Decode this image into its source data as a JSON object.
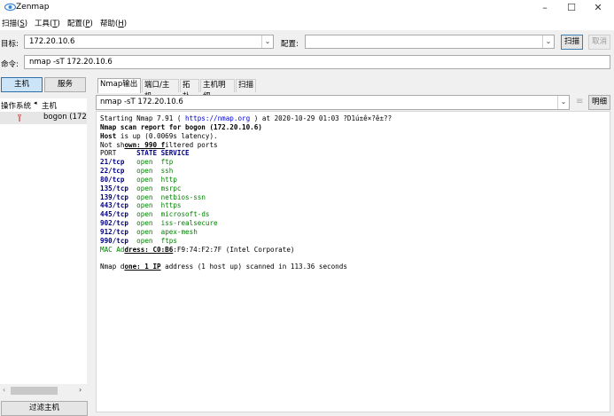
{
  "window": {
    "title": "Zenmap",
    "controls": [
      "–",
      "☐",
      "✕"
    ]
  },
  "menu": [
    {
      "label": "扫描(S)",
      "pre": "扫描(",
      "key": "S",
      "post": ")"
    },
    {
      "label": "工具(T)",
      "pre": "工具(",
      "key": "T",
      "post": ")"
    },
    {
      "label": "配置(P)",
      "pre": "配置(",
      "key": "P",
      "post": ")"
    },
    {
      "label": "帮助(H)",
      "pre": "帮助(",
      "key": "H",
      "post": ")"
    }
  ],
  "toolbar": {
    "target_label": "目标:",
    "target_value": "172.20.10.6",
    "profile_label": "配置:",
    "profile_value": "",
    "scan_button": "扫描",
    "cancel_button": "取消",
    "command_label": "命令:",
    "command_value": "nmap -sT 172.20.10.6"
  },
  "left_panel": {
    "hosts_button": "主机",
    "services_button": "服务",
    "os_column": "操作系统",
    "host_column": "主机",
    "hosts": [
      {
        "name": "bogon (172"
      }
    ],
    "filter_button": "过滤主机"
  },
  "tabs": [
    "Nmap输出",
    "端口/主机",
    "拓扑",
    "主机明细",
    "扫描"
  ],
  "output_panel": {
    "command_select": "nmap -sT 172.20.10.6",
    "details_button": "明细",
    "lines": {
      "start_pre": "Starting Nmap 7.91 ( ",
      "start_url": "https://nmap.org",
      "start_post": " ) at 2020-10-29 01:03 ?D1ú±ê×?ê±??",
      "report": "Nmap scan report for bogon (172.20.10.6)",
      "host_up_pre": "Host",
      "host_up_post": " is up (0.0069s latency).",
      "notshown_pre": "Not sh",
      "notshown_u": "own: 990 f",
      "notshown_post": "iltered ports",
      "header_port": "PORT",
      "header_rest": "     STATE SERVICE",
      "done_pre": "Nmap d",
      "done_u": "one: 1 IP",
      "done_post": " address (1 host up) scanned in 113.36 seconds",
      "mac_pre": "MAC Ad",
      "mac_u": "dress: C0:B6",
      "mac_post": ":F9:74:F2:7F (Intel Corporate)"
    },
    "ports": [
      {
        "port": "21/tcp",
        "state": "open",
        "service": "ftp"
      },
      {
        "port": "22/tcp",
        "state": "open",
        "service": "ssh"
      },
      {
        "port": "80/tcp",
        "state": "open",
        "service": "http"
      },
      {
        "port": "135/tcp",
        "state": "open",
        "service": "msrpc"
      },
      {
        "port": "139/tcp",
        "state": "open",
        "service": "netbios-ssn"
      },
      {
        "port": "443/tcp",
        "state": "open",
        "service": "https"
      },
      {
        "port": "445/tcp",
        "state": "open",
        "service": "microsoft-ds"
      },
      {
        "port": "902/tcp",
        "state": "open",
        "service": "iss-realsecure"
      },
      {
        "port": "912/tcp",
        "state": "open",
        "service": "apex-mesh"
      },
      {
        "port": "990/tcp",
        "state": "open",
        "service": "ftps"
      }
    ]
  },
  "icons": {
    "app": "eye-icon",
    "host_os": "unknown-os-icon",
    "scroll_left": "chevron-left-icon",
    "scroll_right": "chevron-right-icon",
    "dropdown": "chevron-down-icon",
    "column_sort": "triangle-left-icon",
    "resize": "drag-handle-icon"
  },
  "colors": {
    "port": "#000080",
    "open": "#008000",
    "url": "#0000cc",
    "selected_row": "#e6e6e6",
    "pressed_tab": "#cce4f7"
  }
}
